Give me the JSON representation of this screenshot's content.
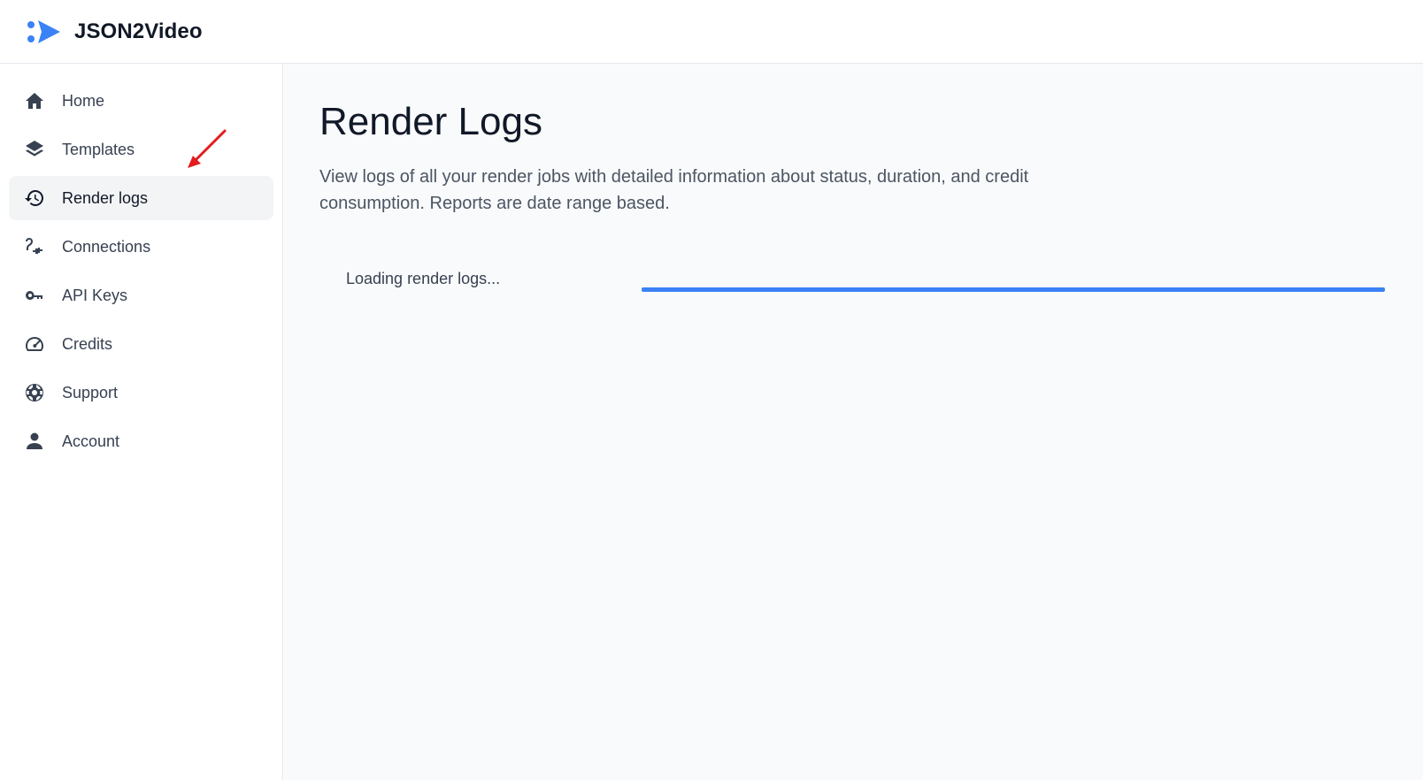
{
  "app": {
    "brand": "JSON2Video"
  },
  "sidebar": {
    "items": [
      {
        "label": "Home",
        "icon": "home-icon",
        "active": false
      },
      {
        "label": "Templates",
        "icon": "layers-icon",
        "active": false
      },
      {
        "label": "Render logs",
        "icon": "history-icon",
        "active": true
      },
      {
        "label": "Connections",
        "icon": "plug-icon",
        "active": false
      },
      {
        "label": "API Keys",
        "icon": "key-icon",
        "active": false
      },
      {
        "label": "Credits",
        "icon": "gauge-icon",
        "active": false
      },
      {
        "label": "Support",
        "icon": "lifebuoy-icon",
        "active": false
      },
      {
        "label": "Account",
        "icon": "user-icon",
        "active": false
      }
    ]
  },
  "main": {
    "title": "Render Logs",
    "description": "View logs of all your render jobs with detailed information about status, duration, and credit consumption. Reports are date range based.",
    "loading_text": "Loading render logs...",
    "progress": 1.0
  },
  "colors": {
    "accent": "#3b82f6",
    "annotation": "#e11d1d",
    "sidebar_active_bg": "#f3f4f6",
    "main_bg": "#f9fafb"
  }
}
